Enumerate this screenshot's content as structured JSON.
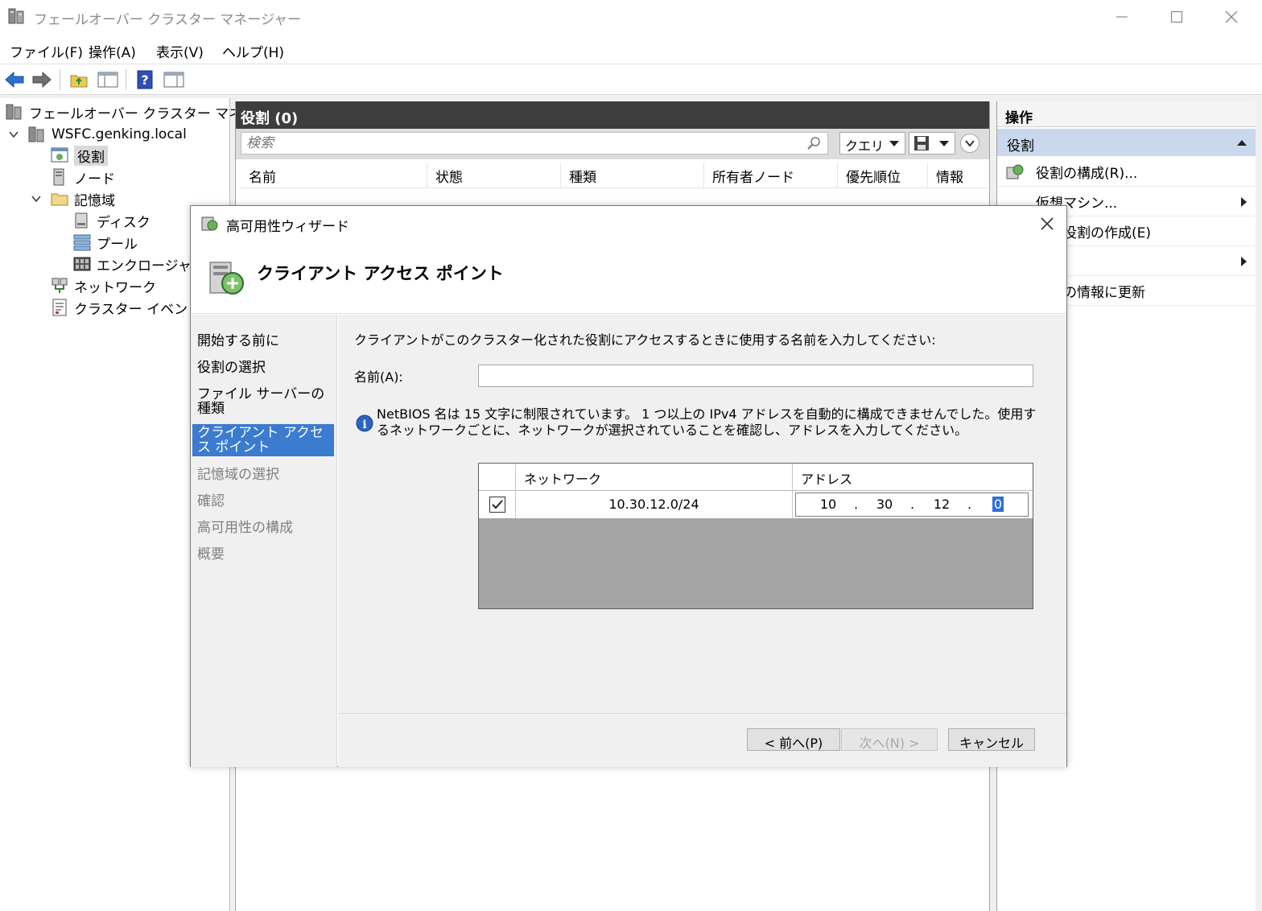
{
  "window": {
    "title": "フェールオーバー クラスター マネージャー"
  },
  "menu": [
    "ファイル(F)",
    "操作(A)",
    "表示(V)",
    "ヘルプ(H)"
  ],
  "tree": {
    "root": "フェールオーバー クラスター マネージャー",
    "cluster": "WSFC.genking.local",
    "roles": "役割",
    "nodes": "ノード",
    "storage": "記憶域",
    "disks": "ディスク",
    "pools": "プール",
    "enclosures": "エンクロージャ",
    "networks": "ネットワーク",
    "events": "クラスター イベント"
  },
  "center": {
    "header": "役割 (0)",
    "search_placeholder": "検索",
    "query_label": "クエリ",
    "columns": [
      "名前",
      "状態",
      "種類",
      "所有者ノード",
      "優先順位",
      "情報"
    ]
  },
  "actions": {
    "header": "操作",
    "section": "役割",
    "items": [
      "役割の構成(R)...",
      "仮想マシン...",
      "空の役割の作成(E)",
      "",
      "最新の情報に更新"
    ]
  },
  "wizard": {
    "title": "高可用性ウィザード",
    "page_title": "クライアント アクセス ポイント",
    "steps": [
      "開始する前に",
      "役割の選択",
      "ファイル サーバーの種類",
      "クライアント アクセス ポイント",
      "記憶域の選択",
      "確認",
      "高可用性の構成",
      "概要"
    ],
    "prompt": "クライアントがこのクラスター化された役割にアクセスするときに使用する名前を入力してください:",
    "name_label": "名前(A):",
    "name_value": "",
    "info": "NetBIOS 名は 15 文字に制限されています。 1 つ以上の IPv4 アドレスを自動的に構成できませんでした。使用するネットワークごとに、ネットワークが選択されていることを確認し、アドレスを入力してください。",
    "grid": {
      "col_network": "ネットワーク",
      "col_address": "アドレス",
      "network": "10.30.12.0/24",
      "ip": [
        "10",
        "30",
        "12",
        "0"
      ],
      "checked": true
    },
    "buttons": {
      "back": "< 前へ(P)",
      "next": "次へ(N) >",
      "cancel": "キャンセル"
    }
  },
  "colors": {
    "selection_blue": "#3b7bd0",
    "pane_header": "#3d3d3d",
    "actions_section": "#c9d8ec"
  }
}
